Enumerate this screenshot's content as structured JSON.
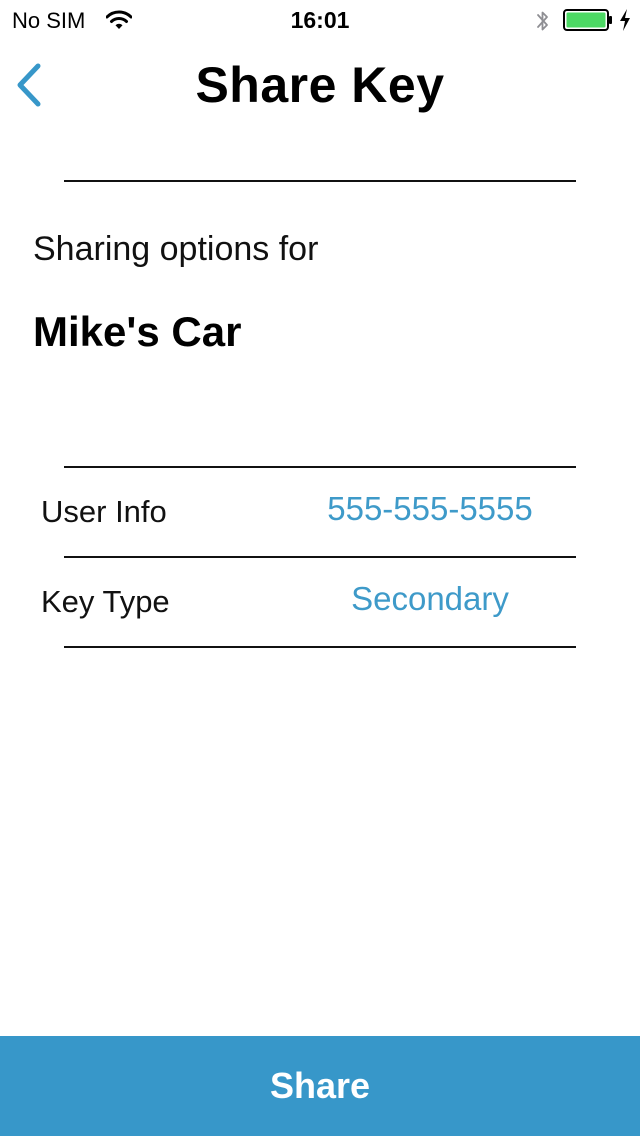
{
  "status_bar": {
    "carrier": "No SIM",
    "time": "16:01",
    "icons": [
      "wifi-icon",
      "bluetooth-icon",
      "battery-icon",
      "charging-icon"
    ],
    "battery_color": "#4cd964"
  },
  "nav": {
    "title": "Share Key",
    "back_icon": "chevron-left-icon"
  },
  "header": {
    "subtitle": "Sharing options for",
    "vehicle_name": "Mike's Car"
  },
  "options": [
    {
      "label": "User Info",
      "value": "555-555-5555"
    },
    {
      "label": "Key Type",
      "value": "Secondary"
    }
  ],
  "share_button": {
    "label": "Share"
  },
  "colors": {
    "accent": "#3797c9",
    "value_text": "#3e9ac9"
  }
}
